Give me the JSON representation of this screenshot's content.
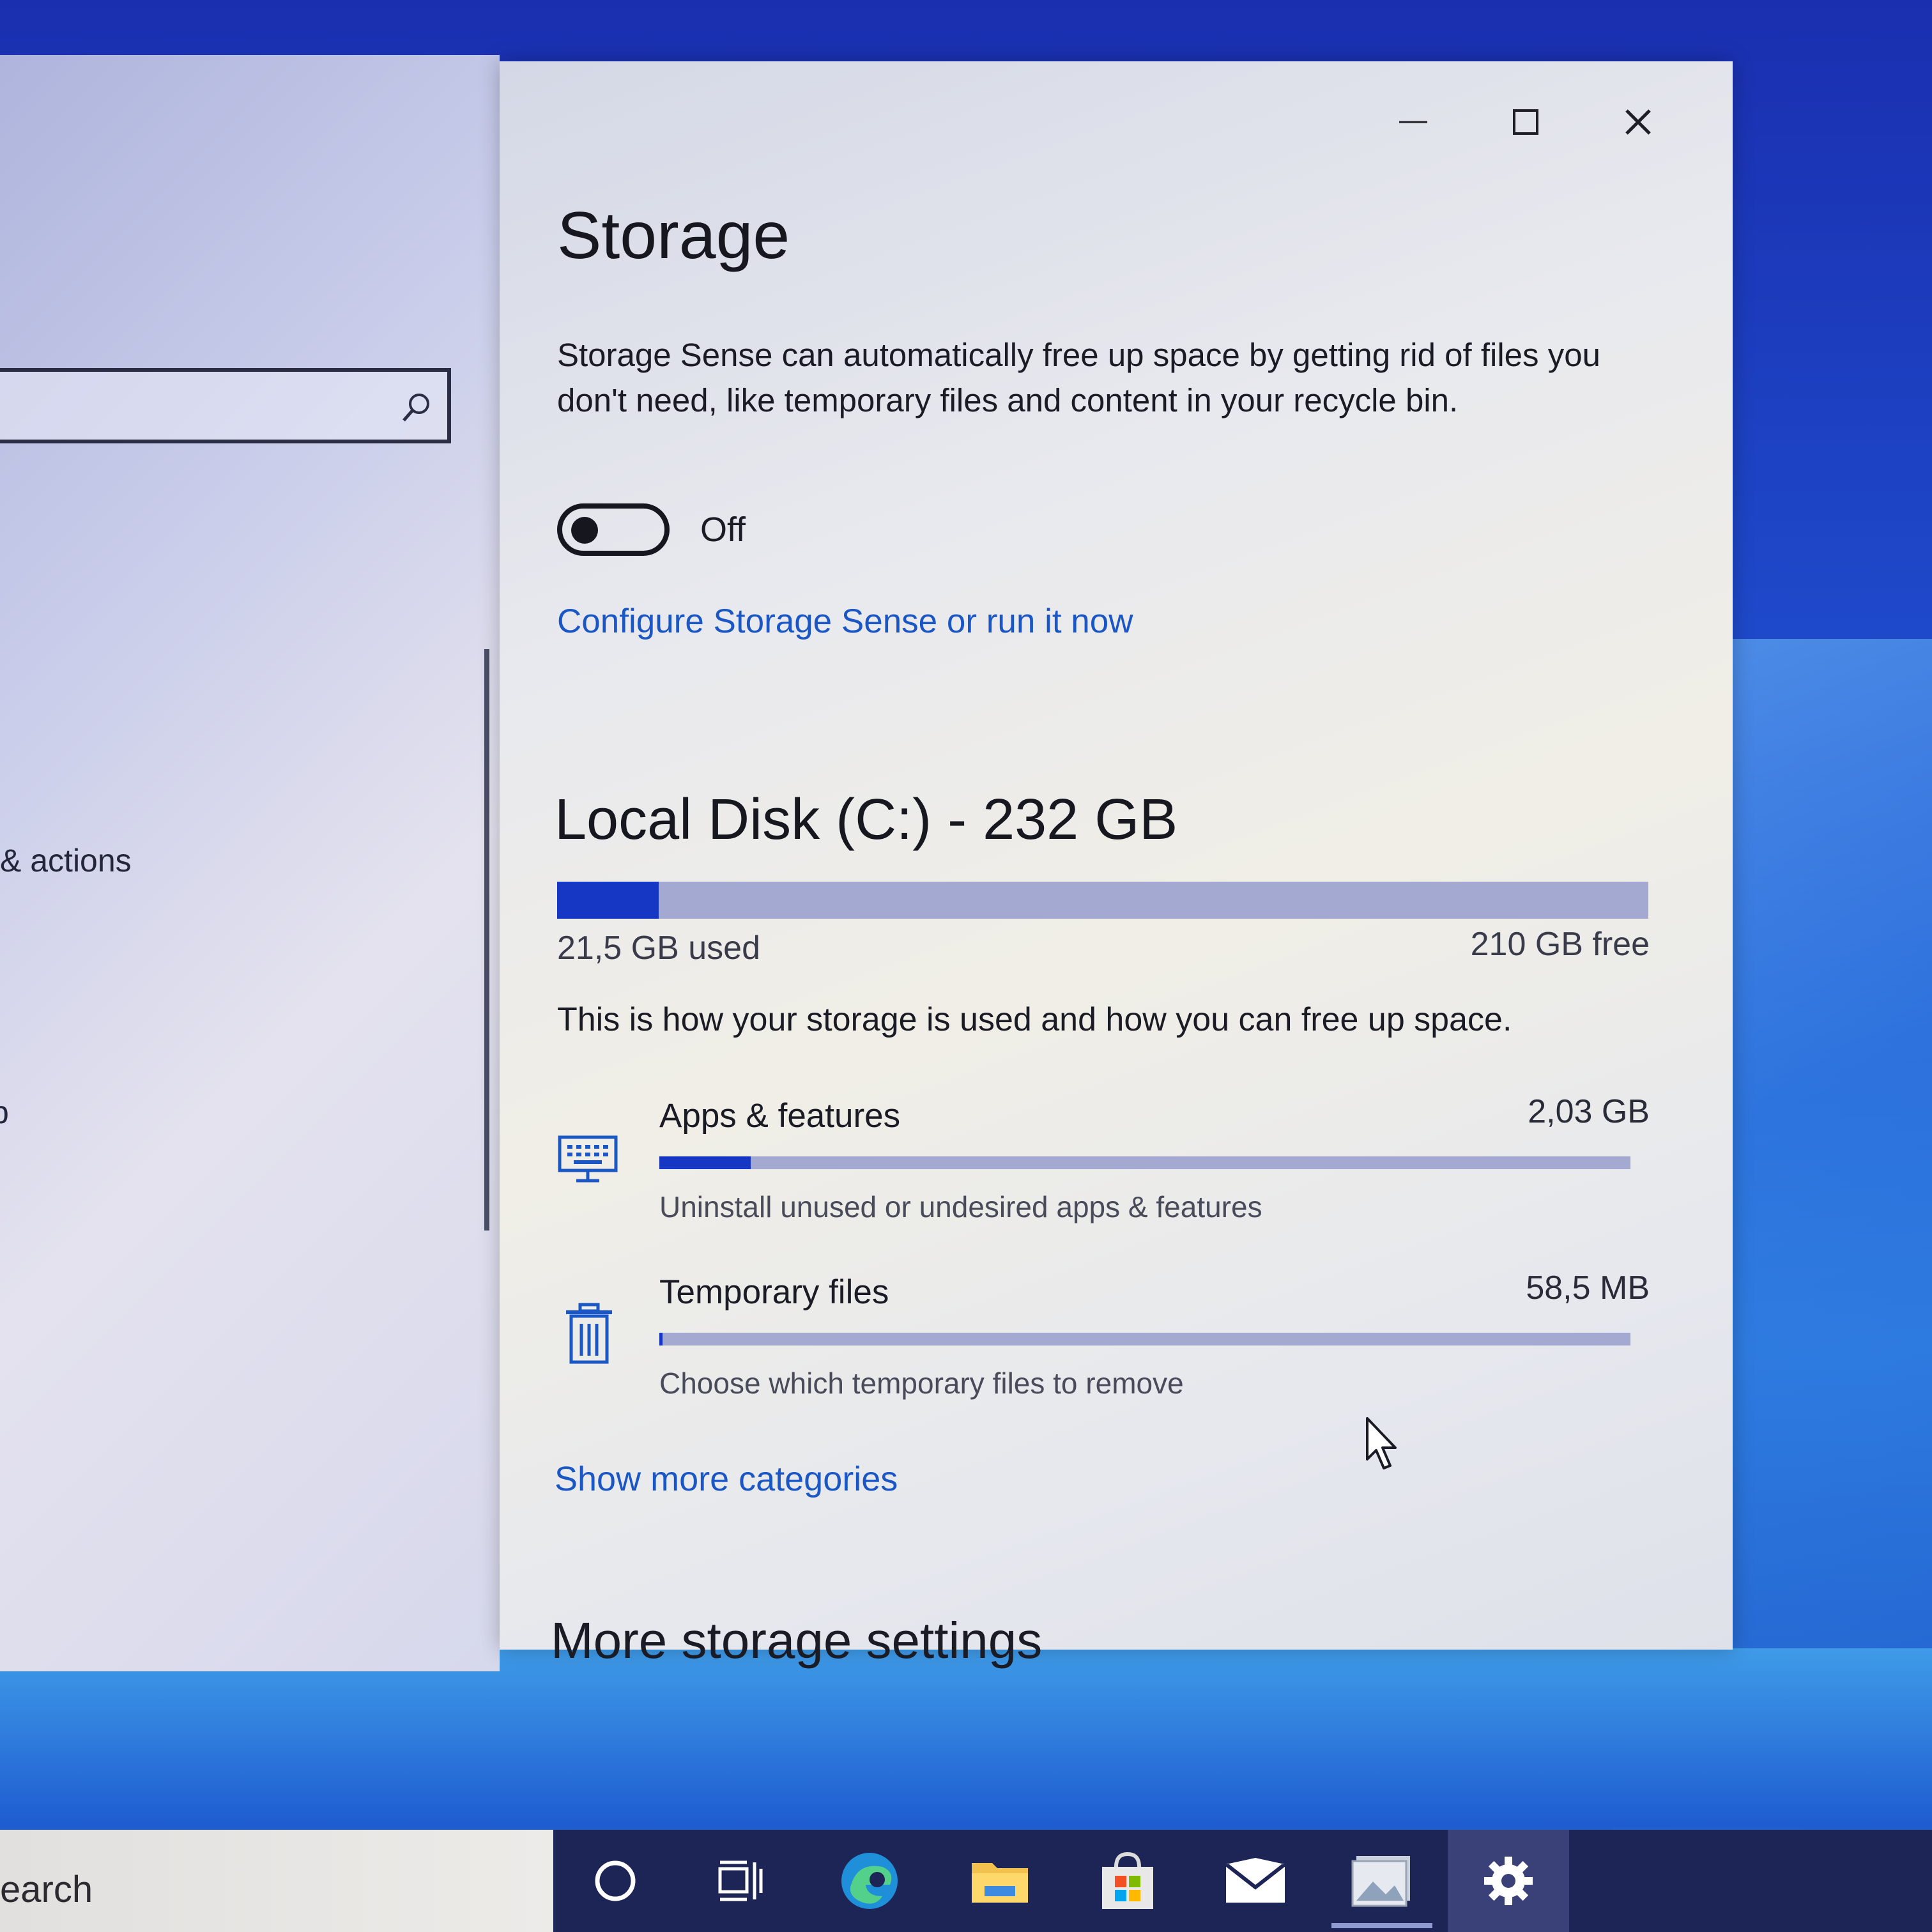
{
  "nav": {
    "search_placeholder": "",
    "items": [
      {
        "label": "& actions"
      },
      {
        "label": "p"
      }
    ]
  },
  "window": {
    "controls": {
      "minimize": "—",
      "maximize": "☐",
      "close": "✕"
    }
  },
  "page_title": "Storage",
  "storage_sense": {
    "description": "Storage Sense can automatically free up space by getting rid of files you don't need, like temporary files and content in your recycle bin.",
    "toggle_state": "Off",
    "toggle_on": false,
    "configure_link": "Configure Storage Sense or run it now"
  },
  "disk": {
    "title": "Local Disk (C:) - 232 GB",
    "used_label": "21,5 GB used",
    "free_label": "210 GB free",
    "used_fraction": 0.093
  },
  "usage_description": "This is how your storage is used and how you can free up space.",
  "categories": [
    {
      "name": "Apps & features",
      "size": "2,03 GB",
      "subtitle": "Uninstall unused or undesired apps & features",
      "icon": "monitor-keyboard-icon",
      "fraction": 0.094
    },
    {
      "name": "Temporary files",
      "size": "58,5 MB",
      "subtitle": "Choose which temporary files to remove",
      "icon": "trash-icon",
      "fraction": 0.003
    }
  ],
  "show_more_link": "Show more categories",
  "more_settings_heading": "More storage settings",
  "taskbar": {
    "search_text": "earch",
    "icons": [
      "cortana-circle-icon",
      "task-view-icon",
      "edge-icon",
      "file-explorer-icon",
      "store-icon",
      "mail-icon",
      "photos-icon",
      "settings-gear-icon"
    ],
    "active": "settings-gear-icon"
  },
  "colors": {
    "accent": "#1537c4",
    "link": "#1a56c4",
    "taskbar": "#1d2456"
  }
}
